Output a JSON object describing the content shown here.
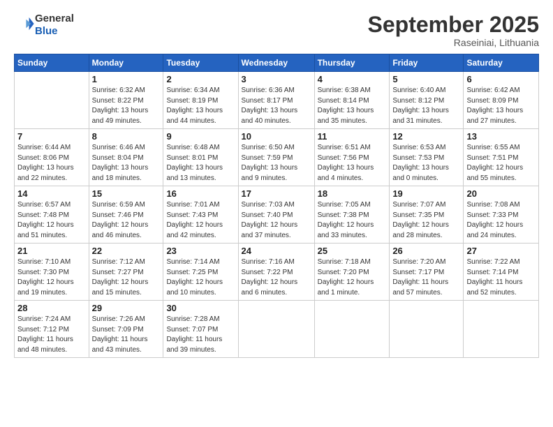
{
  "header": {
    "logo_line1": "General",
    "logo_line2": "Blue",
    "month": "September 2025",
    "location": "Raseiniai, Lithuania"
  },
  "days_of_week": [
    "Sunday",
    "Monday",
    "Tuesday",
    "Wednesday",
    "Thursday",
    "Friday",
    "Saturday"
  ],
  "weeks": [
    [
      {
        "day": "",
        "info": ""
      },
      {
        "day": "1",
        "info": "Sunrise: 6:32 AM\nSunset: 8:22 PM\nDaylight: 13 hours\nand 49 minutes."
      },
      {
        "day": "2",
        "info": "Sunrise: 6:34 AM\nSunset: 8:19 PM\nDaylight: 13 hours\nand 44 minutes."
      },
      {
        "day": "3",
        "info": "Sunrise: 6:36 AM\nSunset: 8:17 PM\nDaylight: 13 hours\nand 40 minutes."
      },
      {
        "day": "4",
        "info": "Sunrise: 6:38 AM\nSunset: 8:14 PM\nDaylight: 13 hours\nand 35 minutes."
      },
      {
        "day": "5",
        "info": "Sunrise: 6:40 AM\nSunset: 8:12 PM\nDaylight: 13 hours\nand 31 minutes."
      },
      {
        "day": "6",
        "info": "Sunrise: 6:42 AM\nSunset: 8:09 PM\nDaylight: 13 hours\nand 27 minutes."
      }
    ],
    [
      {
        "day": "7",
        "info": "Sunrise: 6:44 AM\nSunset: 8:06 PM\nDaylight: 13 hours\nand 22 minutes."
      },
      {
        "day": "8",
        "info": "Sunrise: 6:46 AM\nSunset: 8:04 PM\nDaylight: 13 hours\nand 18 minutes."
      },
      {
        "day": "9",
        "info": "Sunrise: 6:48 AM\nSunset: 8:01 PM\nDaylight: 13 hours\nand 13 minutes."
      },
      {
        "day": "10",
        "info": "Sunrise: 6:50 AM\nSunset: 7:59 PM\nDaylight: 13 hours\nand 9 minutes."
      },
      {
        "day": "11",
        "info": "Sunrise: 6:51 AM\nSunset: 7:56 PM\nDaylight: 13 hours\nand 4 minutes."
      },
      {
        "day": "12",
        "info": "Sunrise: 6:53 AM\nSunset: 7:53 PM\nDaylight: 13 hours\nand 0 minutes."
      },
      {
        "day": "13",
        "info": "Sunrise: 6:55 AM\nSunset: 7:51 PM\nDaylight: 12 hours\nand 55 minutes."
      }
    ],
    [
      {
        "day": "14",
        "info": "Sunrise: 6:57 AM\nSunset: 7:48 PM\nDaylight: 12 hours\nand 51 minutes."
      },
      {
        "day": "15",
        "info": "Sunrise: 6:59 AM\nSunset: 7:46 PM\nDaylight: 12 hours\nand 46 minutes."
      },
      {
        "day": "16",
        "info": "Sunrise: 7:01 AM\nSunset: 7:43 PM\nDaylight: 12 hours\nand 42 minutes."
      },
      {
        "day": "17",
        "info": "Sunrise: 7:03 AM\nSunset: 7:40 PM\nDaylight: 12 hours\nand 37 minutes."
      },
      {
        "day": "18",
        "info": "Sunrise: 7:05 AM\nSunset: 7:38 PM\nDaylight: 12 hours\nand 33 minutes."
      },
      {
        "day": "19",
        "info": "Sunrise: 7:07 AM\nSunset: 7:35 PM\nDaylight: 12 hours\nand 28 minutes."
      },
      {
        "day": "20",
        "info": "Sunrise: 7:08 AM\nSunset: 7:33 PM\nDaylight: 12 hours\nand 24 minutes."
      }
    ],
    [
      {
        "day": "21",
        "info": "Sunrise: 7:10 AM\nSunset: 7:30 PM\nDaylight: 12 hours\nand 19 minutes."
      },
      {
        "day": "22",
        "info": "Sunrise: 7:12 AM\nSunset: 7:27 PM\nDaylight: 12 hours\nand 15 minutes."
      },
      {
        "day": "23",
        "info": "Sunrise: 7:14 AM\nSunset: 7:25 PM\nDaylight: 12 hours\nand 10 minutes."
      },
      {
        "day": "24",
        "info": "Sunrise: 7:16 AM\nSunset: 7:22 PM\nDaylight: 12 hours\nand 6 minutes."
      },
      {
        "day": "25",
        "info": "Sunrise: 7:18 AM\nSunset: 7:20 PM\nDaylight: 12 hours\nand 1 minute."
      },
      {
        "day": "26",
        "info": "Sunrise: 7:20 AM\nSunset: 7:17 PM\nDaylight: 11 hours\nand 57 minutes."
      },
      {
        "day": "27",
        "info": "Sunrise: 7:22 AM\nSunset: 7:14 PM\nDaylight: 11 hours\nand 52 minutes."
      }
    ],
    [
      {
        "day": "28",
        "info": "Sunrise: 7:24 AM\nSunset: 7:12 PM\nDaylight: 11 hours\nand 48 minutes."
      },
      {
        "day": "29",
        "info": "Sunrise: 7:26 AM\nSunset: 7:09 PM\nDaylight: 11 hours\nand 43 minutes."
      },
      {
        "day": "30",
        "info": "Sunrise: 7:28 AM\nSunset: 7:07 PM\nDaylight: 11 hours\nand 39 minutes."
      },
      {
        "day": "",
        "info": ""
      },
      {
        "day": "",
        "info": ""
      },
      {
        "day": "",
        "info": ""
      },
      {
        "day": "",
        "info": ""
      }
    ]
  ]
}
